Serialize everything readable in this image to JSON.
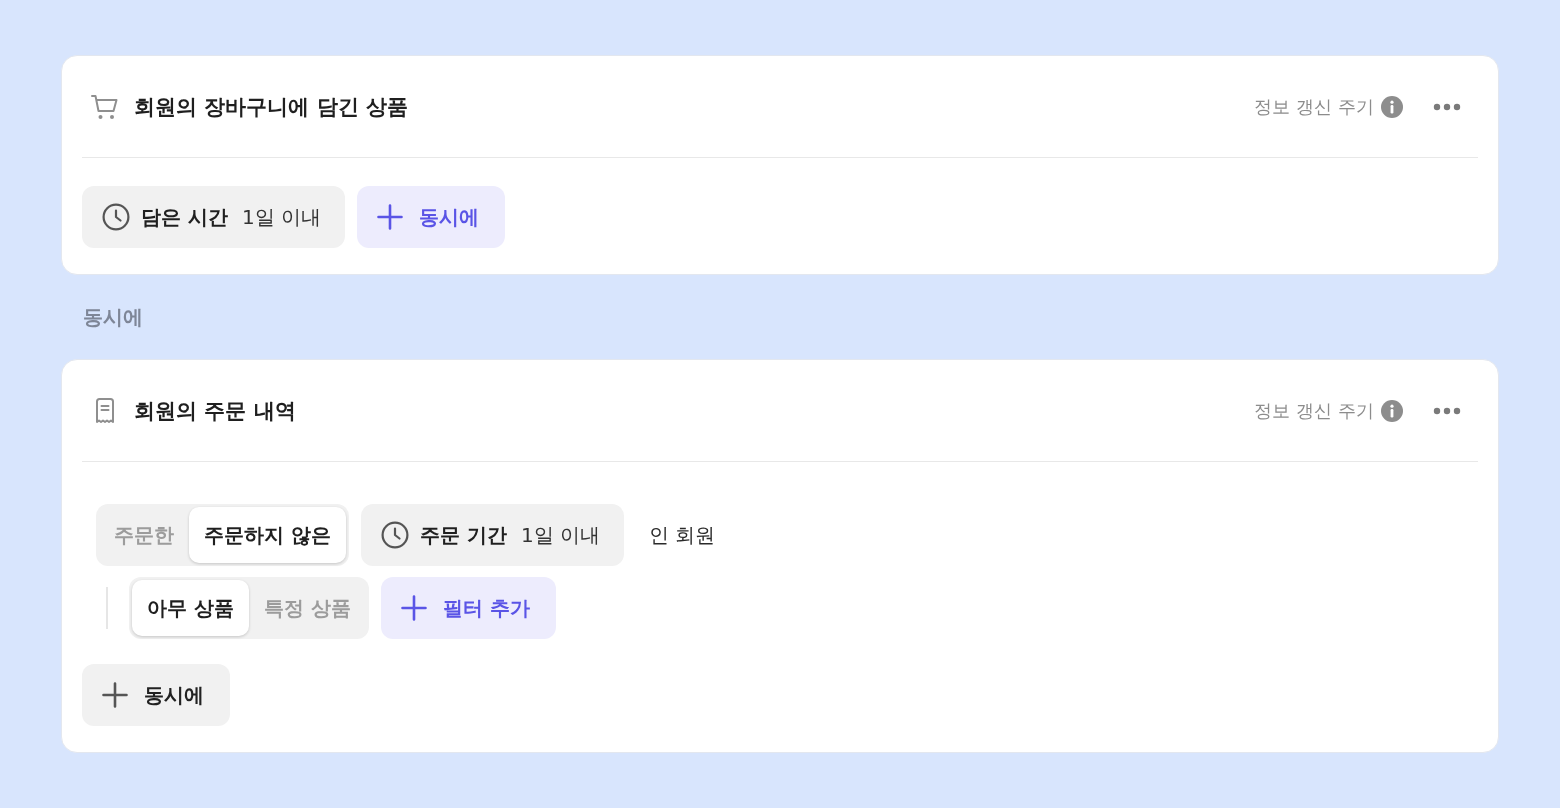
{
  "blocks": [
    {
      "kind": "cart_card",
      "title": "회원의 장바구니에 담긴 상품",
      "refresh_label": "정보 갱신 주기",
      "body": [
        {
          "kind": "row",
          "items": [
            {
              "kind": "condition",
              "label": "담은 시간",
              "value": "1일 이내"
            },
            {
              "kind": "add_accent",
              "label": "동시에"
            }
          ]
        }
      ]
    },
    {
      "kind": "connector",
      "label": "동시에"
    },
    {
      "kind": "order_card",
      "title": "회원의 주문 내역",
      "refresh_label": "정보 갱신 주기",
      "body": [
        {
          "kind": "group",
          "rows": [
            {
              "items": [
                {
                  "kind": "segmented",
                  "options": [
                    {
                      "label": "주문한",
                      "selected": false
                    },
                    {
                      "label": "주문하지 않은",
                      "selected": true
                    }
                  ]
                },
                {
                  "kind": "condition",
                  "label": "주문 기간",
                  "value": "1일 이내"
                },
                {
                  "kind": "text",
                  "text": "인 회원"
                }
              ],
              "children": [
                {
                  "items": [
                    {
                      "kind": "segmented",
                      "options": [
                        {
                          "label": "아무 상품",
                          "selected": true
                        },
                        {
                          "label": "특정 상품",
                          "selected": false
                        }
                      ]
                    },
                    {
                      "kind": "add_accent",
                      "label": "필터 추가"
                    }
                  ]
                }
              ]
            }
          ]
        },
        {
          "kind": "row",
          "items": [
            {
              "kind": "add_neutral",
              "label": "동시에"
            }
          ]
        }
      ]
    }
  ]
}
